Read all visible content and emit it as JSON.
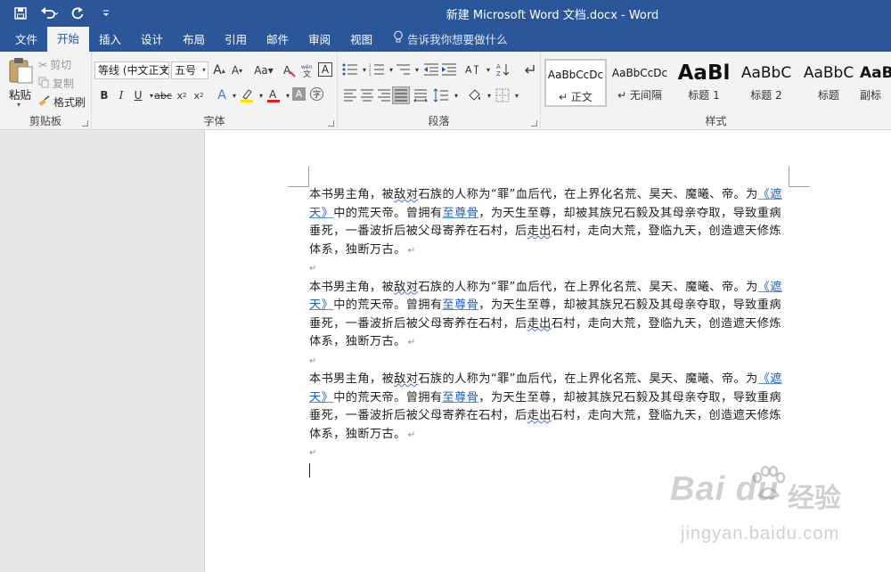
{
  "window": {
    "title": "新建 Microsoft Word 文档.docx  -  Word"
  },
  "quick_access": [
    {
      "icon": "save-icon"
    },
    {
      "icon": "undo-icon"
    },
    {
      "icon": "redo-icon"
    },
    {
      "icon": "customize-icon"
    }
  ],
  "tabs": [
    "文件",
    "开始",
    "插入",
    "设计",
    "布局",
    "引用",
    "邮件",
    "审阅",
    "视图"
  ],
  "active_tab": "开始",
  "tell_me": "告诉我你想要做什么",
  "clipboard": {
    "label": "剪贴板",
    "paste": "粘贴",
    "cut": "剪切",
    "copy": "复制",
    "format_painter": "格式刷"
  },
  "font": {
    "label": "字体",
    "font_name": "等线 (中文正文)",
    "font_size": "五号"
  },
  "paragraph": {
    "label": "段落"
  },
  "styles": {
    "label": "样式",
    "items": [
      {
        "sample": "AaBbCcDc",
        "name": "↵ 正文"
      },
      {
        "sample": "AaBbCcDc",
        "name": "↵ 无间隔"
      },
      {
        "sample": "AaBl",
        "name": "标题 1"
      },
      {
        "sample": "AaBbC",
        "name": "标题 2"
      },
      {
        "sample": "AaBbC",
        "name": "标题"
      },
      {
        "sample": "AaBb",
        "name": "副标"
      }
    ]
  },
  "document": {
    "paragraphs": [
      {
        "t1": " 本书男主角，被",
        "w1": "敌对",
        "t2": "石族的人称为“罪”血后代，在上界化名荒、昊天、魔曦、帝。为",
        "link1": "《遮天》",
        "t3": "中的荒天帝。曾拥有",
        "link2": "至尊骨",
        "t4": "，为天生至尊，却被其族兄石毅及其母亲夺取，导致重病垂死，一番波折后被父母寄养在石村，后",
        "w2": "走出",
        "t5": "石村，走向大荒，登临九天，创造遮天修炼体系，独断万古。"
      },
      {
        "t1": " 本书男主角，被",
        "w1": "敌对",
        "t2": "石族的人称为“罪”血后代，在上界化名荒、昊天、魔曦、帝。为",
        "link1": "《遮天》",
        "t3": "中的荒天帝。曾拥有",
        "link2": "至尊骨",
        "t4": "，为天生至尊，却被其族兄石毅及其母亲夺取，导致重病垂死，一番波折后被父母寄养在石村，后",
        "w2": "走出",
        "t5": "石村，走向大荒，登临九天，创造遮天修炼体系，独断万古。"
      },
      {
        "t1": " 本书男主角，被",
        "w1": "敌对",
        "t2": "石族的人称为“罪”血后代，在上界化名荒、昊天、魔曦、帝。为",
        "link1": "《遮天》",
        "t3": "中的荒天帝。曾拥有",
        "link2": "至尊骨",
        "t4": "，为天生至尊，却被其族兄石毅及其母亲夺取，导致重病垂死，一番波折后被父母寄养在石村，后",
        "w2": "走出",
        "t5": "石村，走向大荒，登临九天，创造遮天修炼体系，独断万古。"
      }
    ],
    "para_mark": "↵"
  },
  "watermark": {
    "logo": "Bai du",
    "brand": "经验",
    "url": "jingyan.baidu.com"
  },
  "colors": {
    "ribbon_blue": "#2b579a",
    "link": "#1f5fbf",
    "font_color_red": "#e02020",
    "highlight_yellow": "#ffe000"
  }
}
